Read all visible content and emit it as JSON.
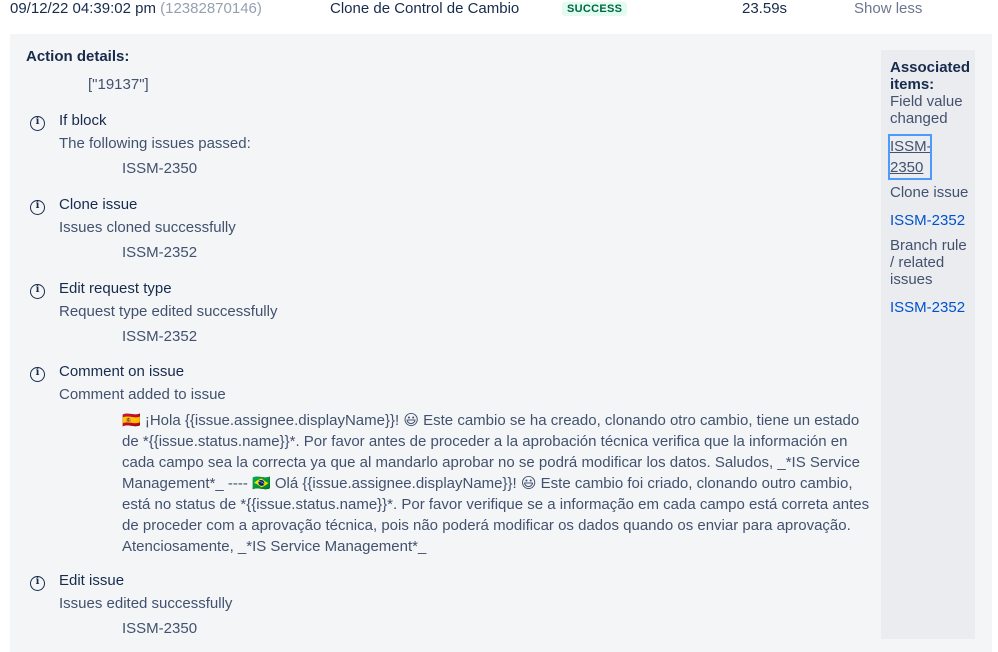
{
  "header": {
    "timestamp": "09/12/22 04:39:02 pm",
    "execution_id": "(12382870146)",
    "rule_name": "Clone de Control de Cambio",
    "status": "SUCCESS",
    "duration": "23.59s",
    "toggle_label": "Show less"
  },
  "details": {
    "title": "Action details:",
    "value": "[\"19137\"]",
    "actions": [
      {
        "name": "If block",
        "message": "The following issues passed:",
        "key": "ISSM-2350"
      },
      {
        "name": "Clone issue",
        "message": "Issues cloned successfully",
        "key": "ISSM-2352"
      },
      {
        "name": "Edit request type",
        "message": "Request type edited successfully",
        "key": "ISSM-2352"
      },
      {
        "name": "Comment on issue",
        "message": "Comment added to issue",
        "comment": "🇪🇸 ¡Hola {{issue.assignee.displayName}}! 😃 Este cambio se ha creado, clonando otro cambio, tiene un estado de *{{issue.status.name}}*. Por favor antes de proceder a la aprobación técnica verifica que la información en cada campo sea la correcta ya que al mandarlo aprobar no se podrá modificar los datos. Saludos, _*IS Service Management*_ ---- 🇧🇷 Olá {{issue.assignee.displayName}}! 😃 Este cambio foi criado, clonando outro cambio, está no status de *{{issue.status.name}}*. Por favor verifique se a informação em cada campo está correta antes de proceder com a aprovação técnica, pois não poderá modificar os dados quando os enviar para aprovação. Atenciosamente, _*IS Service Management*_"
      },
      {
        "name": "Edit issue",
        "message": "Issues edited successfully",
        "key": "ISSM-2350"
      }
    ]
  },
  "associated": {
    "title": "Associated items:",
    "groups": [
      {
        "label": "Field value changed",
        "link": "ISSM-2350"
      },
      {
        "label": "Clone issue",
        "link": "ISSM-2352"
      },
      {
        "label": "Branch rule / related issues",
        "link": "ISSM-2352"
      }
    ]
  }
}
